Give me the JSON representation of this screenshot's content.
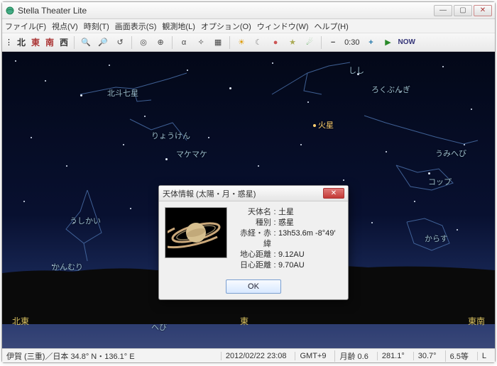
{
  "window": {
    "title": "Stella Theater Lite"
  },
  "menus": [
    "ファイル(F)",
    "視点(V)",
    "時刻(T)",
    "画面表示(S)",
    "観測地(L)",
    "オプション(O)",
    "ウィンドウ(W)",
    "ヘルプ(H)"
  ],
  "toolbar": {
    "dirs": [
      "北",
      "東",
      "南",
      "西"
    ],
    "time_step": "0:30",
    "now": "NOW"
  },
  "constellations": {
    "big_dipper": "北斗七星",
    "ryouken": "りょうけん",
    "makemake": "マケマケ",
    "ushikai": "うしかい",
    "kanmuri": "かんむり",
    "hebi": "へび",
    "shishi": "しし",
    "rokubungi": "ろくぶんぎ",
    "umihebi": "うみへび",
    "koppu": "コップ",
    "karasu": "からす"
  },
  "planets": {
    "mars": "火星",
    "saturn": "土星"
  },
  "horizon": {
    "ne": "北東",
    "e": "東",
    "se": "東南"
  },
  "dialog": {
    "title": "天体情報 (太陽・月・惑星)",
    "fields": {
      "name_k": "天体名",
      "name_v": "土星",
      "type_k": "種別",
      "type_v": "惑星",
      "radec_k": "赤経・赤緯",
      "radec_v": "13h53.6m   -8°49′",
      "geo_k": "地心距離",
      "geo_v": "9.12AU",
      "helio_k": "日心距離",
      "helio_v": "9.70AU"
    },
    "ok": "OK"
  },
  "status": {
    "loc": "伊賀 (三重)／日本  34.8° N・136.1° E",
    "date": "2012/02/22  23:08",
    "tz": "GMT+9",
    "moon_age": "月齢 0.6",
    "az": "281.1°",
    "alt": "30.7°",
    "mag": "6.5等",
    "mode": "L"
  }
}
